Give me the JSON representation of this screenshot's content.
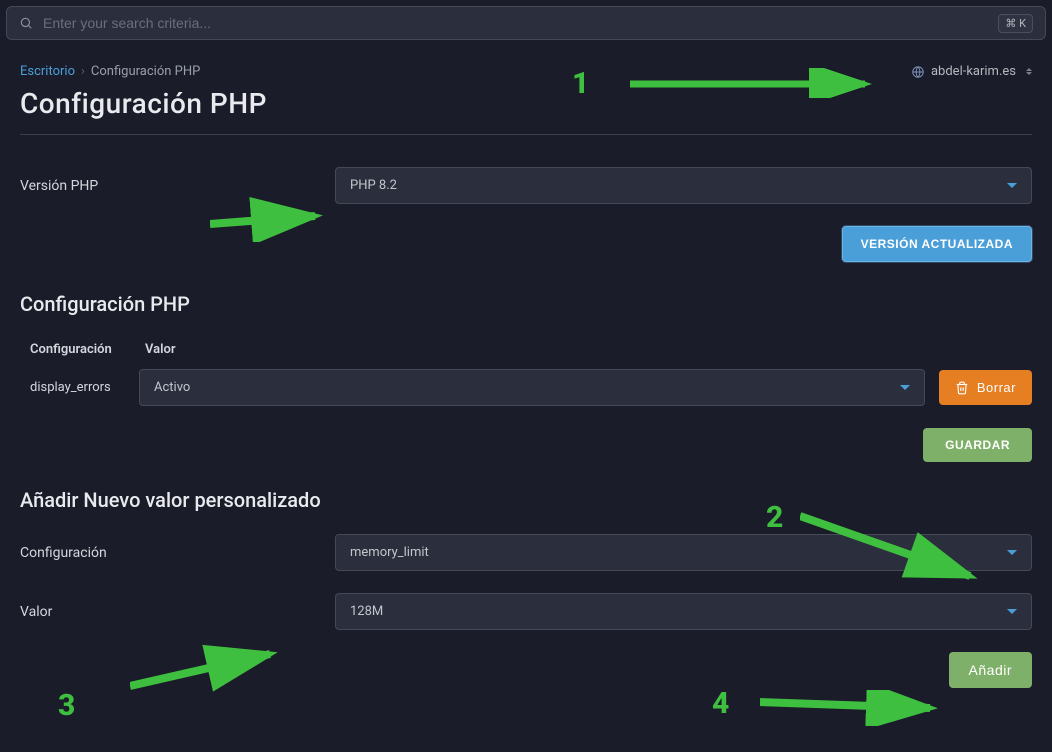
{
  "search": {
    "placeholder": "Enter your search criteria...",
    "shortcut": "⌘ K"
  },
  "breadcrumb": {
    "home": "Escritorio",
    "current": "Configuración PHP"
  },
  "domain": "abdel-karim.es",
  "page_title": "Configuración PHP",
  "php_version": {
    "label": "Versión PHP",
    "value": "PHP 8.2"
  },
  "buttons": {
    "update_version": "VERSIÓN ACTUALIZADA",
    "save": "GUARDAR",
    "delete": "Borrar",
    "add": "Añadir"
  },
  "config_section": {
    "heading": "Configuración PHP",
    "columns": {
      "config": "Configuración",
      "value": "Valor"
    },
    "rows": [
      {
        "name": "display_errors",
        "value": "Activo"
      }
    ]
  },
  "add_section": {
    "heading": "Añadir Nuevo valor personalizado",
    "config_label": "Configuración",
    "config_value": "memory_limit",
    "value_label": "Valor",
    "value_value": "128M"
  },
  "annotations": {
    "a1": "1",
    "a2": "2",
    "a3": "3",
    "a4": "4"
  }
}
